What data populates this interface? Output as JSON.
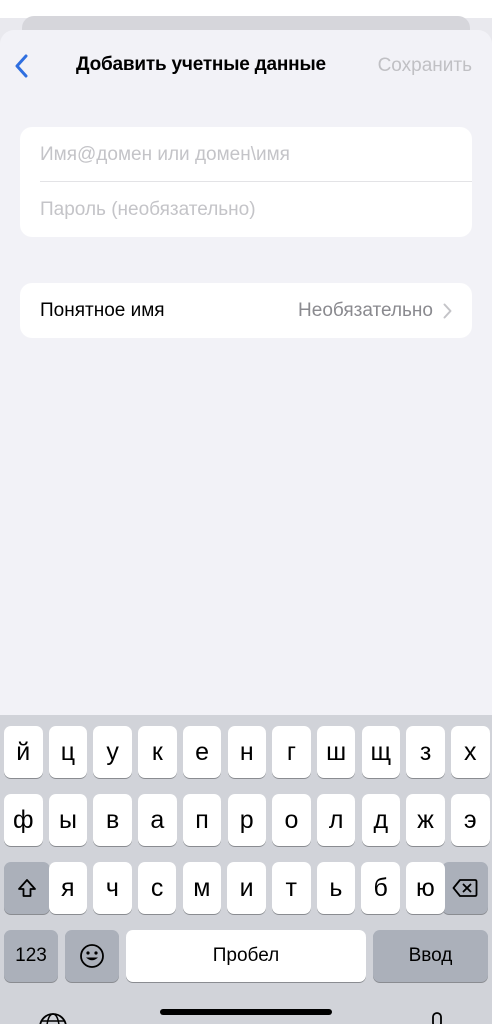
{
  "nav": {
    "title": "Добавить учетные данные",
    "save_label": "Сохранить"
  },
  "credentials": {
    "username_placeholder": "Имя@домен или домен\\имя",
    "username_value": "",
    "password_placeholder": "Пароль (необязательно)",
    "password_value": ""
  },
  "friendly_name": {
    "label": "Понятное имя",
    "value": "Необязательно"
  },
  "keyboard": {
    "row1": [
      "й",
      "ц",
      "у",
      "к",
      "е",
      "н",
      "г",
      "ш",
      "щ",
      "з",
      "х"
    ],
    "row2": [
      "ф",
      "ы",
      "в",
      "а",
      "п",
      "р",
      "о",
      "л",
      "д",
      "ж",
      "э"
    ],
    "row3": [
      "я",
      "ч",
      "с",
      "м",
      "и",
      "т",
      "ь",
      "б",
      "ю"
    ],
    "numbers_label": "123",
    "space_label": "Пробел",
    "return_label": "Ввод"
  },
  "colors": {
    "accent": "#2f6fe0",
    "sheet_bg": "#f2f2f7",
    "keyboard_bg": "#d1d3d9"
  }
}
